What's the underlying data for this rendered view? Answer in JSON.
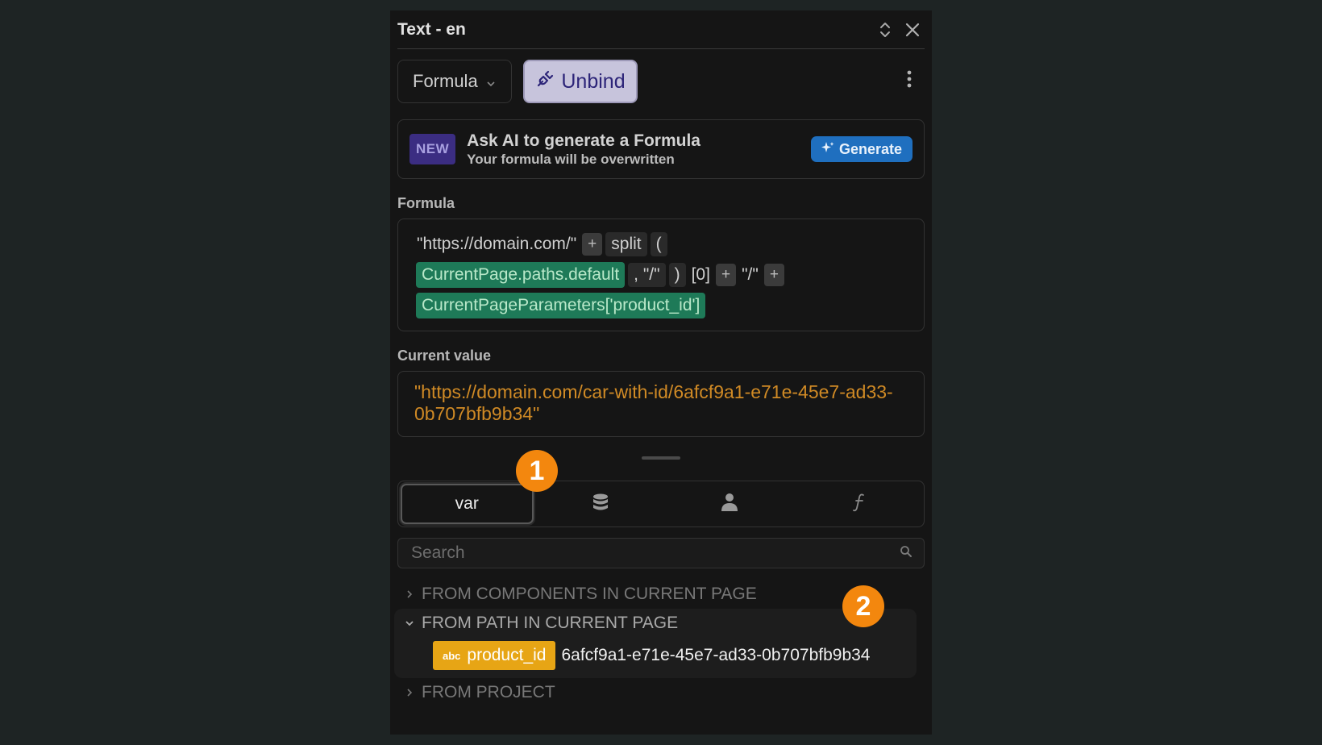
{
  "panel": {
    "title": "Text - en",
    "icons": {
      "expand": "unfold-icon",
      "close": "close-icon",
      "more": "kebab-icon"
    }
  },
  "toolbar": {
    "mode_label": "Formula",
    "unbind_label": "Unbind"
  },
  "ai": {
    "badge": "NEW",
    "title": "Ask AI to generate a Formula",
    "subtitle": "Your formula will be overwritten",
    "button_label": "Generate"
  },
  "formula": {
    "label": "Formula",
    "tokens": {
      "str1": "\"https://domain.com/\"",
      "plus": "+",
      "fn": "split",
      "lparen": "(",
      "var1": "CurrentPage.paths.default",
      "comma_str": ", \"/\"",
      "rparen": ")",
      "index": "[0]",
      "str2": "\"/\"",
      "var2": "CurrentPageParameters['product_id']"
    }
  },
  "current_value": {
    "label": "Current value",
    "value": "\"https://domain.com/car-with-id/6afcf9a1-e71e-45e7-ad33-0b707bfb9b34\""
  },
  "tabs": [
    {
      "label": "var",
      "icon": "variable-icon",
      "active": true
    },
    {
      "label": "",
      "icon": "database-icon",
      "active": false
    },
    {
      "label": "",
      "icon": "user-icon",
      "active": false
    },
    {
      "label": "",
      "icon": "function-icon",
      "active": false
    }
  ],
  "search": {
    "placeholder": "Search"
  },
  "tree": {
    "section1": "FROM COMPONENTS IN CURRENT PAGE",
    "section2": "FROM PATH IN CURRENT PAGE",
    "section3": "FROM PROJECT",
    "item": {
      "type": "abc",
      "name": "product_id",
      "value": "6afcf9a1-e71e-45e7-ad33-0b707bfb9b34"
    }
  },
  "badges": {
    "one": "1",
    "two": "2"
  },
  "colors": {
    "accent_orange": "#f3870e",
    "variable_green": "#1e7a58",
    "string_value": "#d08a25",
    "generate_blue": "#1f6fbf",
    "item_chip": "#e7a515"
  }
}
